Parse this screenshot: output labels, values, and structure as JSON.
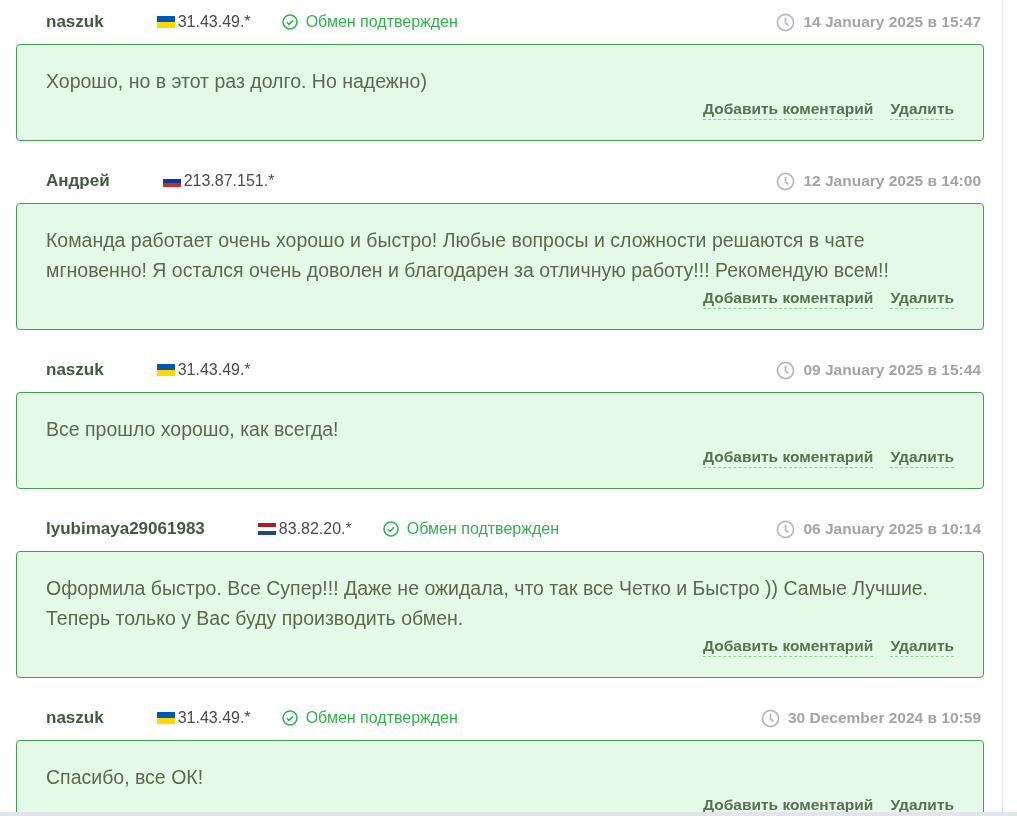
{
  "reviews": [
    {
      "author": "naszuk",
      "kind": "ua",
      "ip": "31.43.49.*",
      "status": "Обмен подтвержден",
      "date": "14 January 2025 в 15:47",
      "text": "Хорошо, но в этот раз долго. Но надежно)",
      "actions": [
        "Добавить коментарий",
        "Удалить"
      ]
    },
    {
      "author": "Андрей",
      "kind": "ru",
      "ip": "213.87.151.*",
      "date": "12 January 2025 в 14:00",
      "text": "Команда работает очень хорошо и быстро! Любые вопросы и сложности решаются в чате мгновенно! Я остался очень доволен и благодарен за отличную работу!!! Рекомендую всем!!",
      "actions": [
        "Добавить коментарий",
        "Удалить"
      ]
    },
    {
      "author": "naszuk",
      "kind": "ua",
      "ip": "31.43.49.*",
      "date": "09 January 2025 в 15:44",
      "text": "Все прошло хорошо, как всегда!",
      "actions": [
        "Добавить коментарий",
        "Удалить"
      ]
    },
    {
      "author": "lyubimaya29061983",
      "kind": "nl",
      "ip": "83.82.20.*",
      "status": "Обмен подтвержден",
      "date": "06 January 2025 в 10:14",
      "text": "Оформила быстро. Все Супер!!! Даже не ожидала, что так все Четко и Быстро )) Самые Лучшие. Теперь только у Вас буду производить обмен.",
      "actions": [
        "Добавить коментарий",
        "Удалить"
      ]
    },
    {
      "author": "naszuk",
      "kind": "ua",
      "ip": "31.43.49.*",
      "status": "Обмен подтвержден",
      "date": "30 December 2024 в 10:59",
      "text": "Спасибо, все ОК!",
      "actions": [
        "Добавить коментарий",
        "Удалить"
      ]
    }
  ]
}
